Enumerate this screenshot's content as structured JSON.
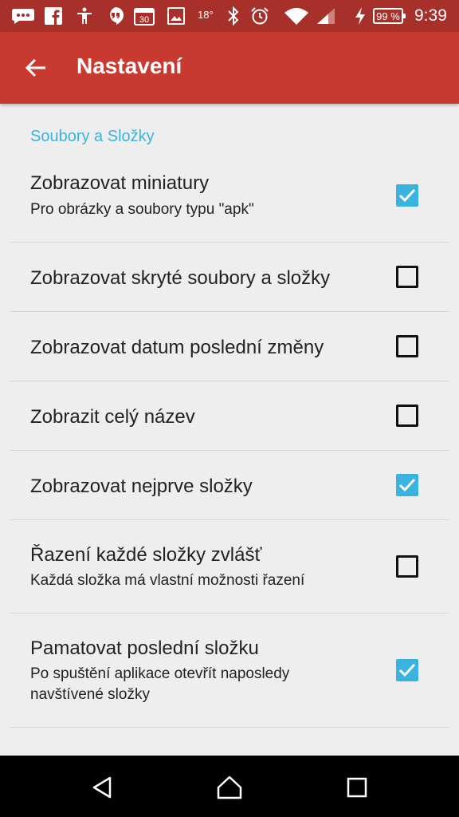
{
  "status_bar": {
    "temperature": "18°",
    "battery": "99 %",
    "time": "9:39",
    "calendar_day": "30",
    "icons": [
      "messenger-icon",
      "facebook-icon",
      "accessibility-icon",
      "hangouts-icon",
      "calendar-icon",
      "image-icon",
      "bluetooth-icon",
      "alarm-icon",
      "wifi-icon",
      "signal-icon",
      "charging-icon"
    ]
  },
  "app_bar": {
    "title": "Nastavení",
    "back_icon": "arrow-back-icon",
    "color": "#C8392F"
  },
  "section": {
    "title": "Soubory a Složky",
    "color": "#3AB3E0"
  },
  "preferences": [
    {
      "title": "Zobrazovat miniatury",
      "summary": "Pro obrázky a soubory typu \"apk\"",
      "checked": true
    },
    {
      "title": "Zobrazovat skryté soubory a složky",
      "summary": "",
      "checked": false
    },
    {
      "title": "Zobrazovat datum poslední změny",
      "summary": "",
      "checked": false
    },
    {
      "title": "Zobrazit celý název",
      "summary": "",
      "checked": false
    },
    {
      "title": "Zobrazovat nejprve složky",
      "summary": "",
      "checked": true
    },
    {
      "title": "Řazení každé složky zvlášť",
      "summary": "Každá složka má vlastní možnosti řazení",
      "checked": false
    },
    {
      "title": "Pamatovat poslední složku",
      "summary": "Po spuštění aplikace otevřít naposledy navštívené složky",
      "checked": true
    }
  ],
  "navigation_bar": {
    "buttons": [
      "back-triangle-icon",
      "home-icon",
      "recents-icon"
    ]
  }
}
